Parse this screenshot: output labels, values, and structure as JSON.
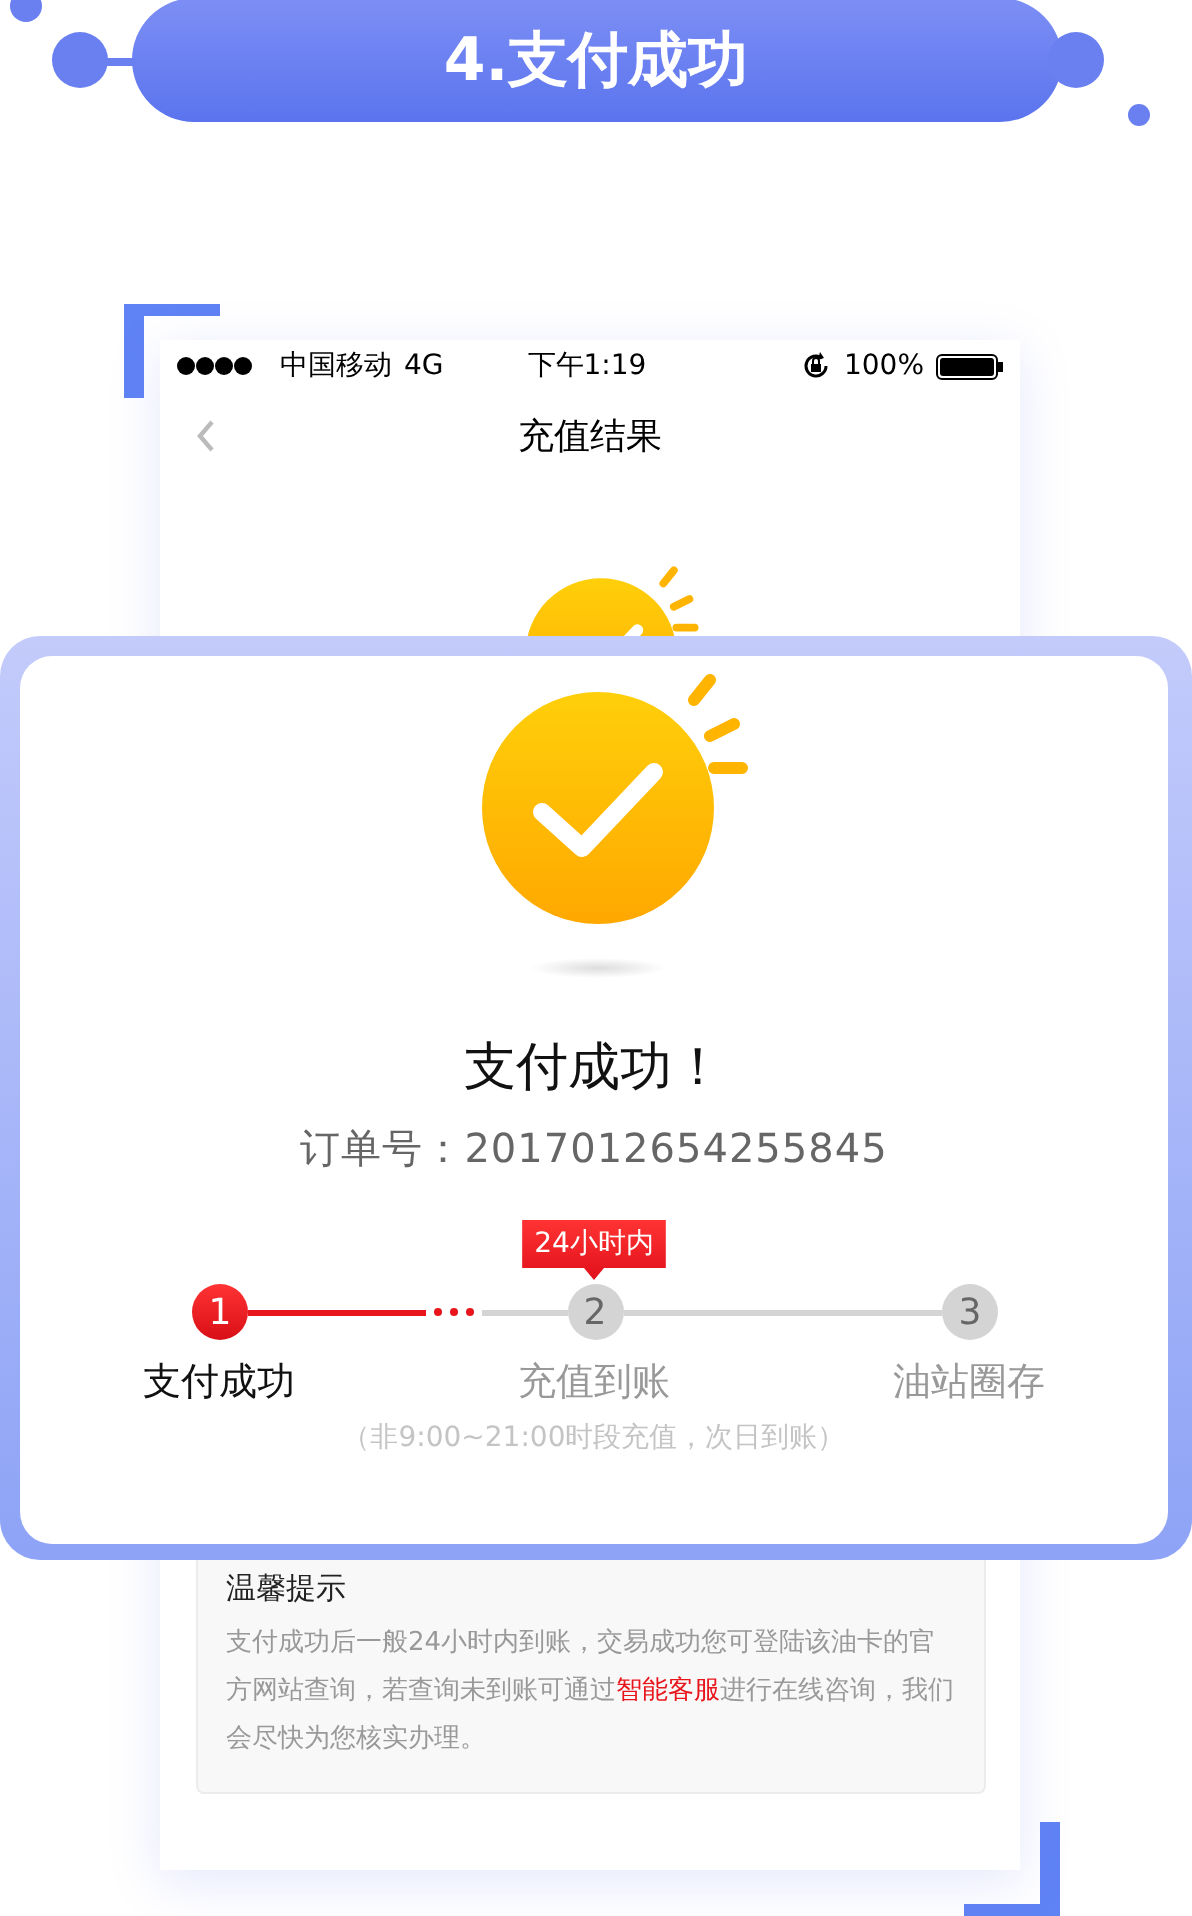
{
  "banner": {
    "title": "4.支付成功"
  },
  "status_bar": {
    "carrier": "中国移动",
    "network": "4G",
    "time": "下午1:19",
    "battery": "100%"
  },
  "nav": {
    "title": "充值结果"
  },
  "result": {
    "title": "支付成功！",
    "order_label": "订单号：",
    "order_number": "2017012654255845"
  },
  "progress_badge": "24小时内",
  "steps": [
    {
      "number": "1",
      "label": "支付成功",
      "done": true
    },
    {
      "number": "2",
      "label": "充值到账",
      "done": false
    },
    {
      "number": "3",
      "label": "油站圈存",
      "done": false
    }
  ],
  "note": "（非9:00~21:00时段充值，次日到账）",
  "tips": {
    "title": "温馨提示",
    "text_before": "支付成功后一般24小时内到账，交易成功您可登陆该油卡的官方网站查询，若查询未到账可通过",
    "link": "智能客服",
    "text_after": "进行在线咨询，我们会尽快为您核实办理。"
  }
}
